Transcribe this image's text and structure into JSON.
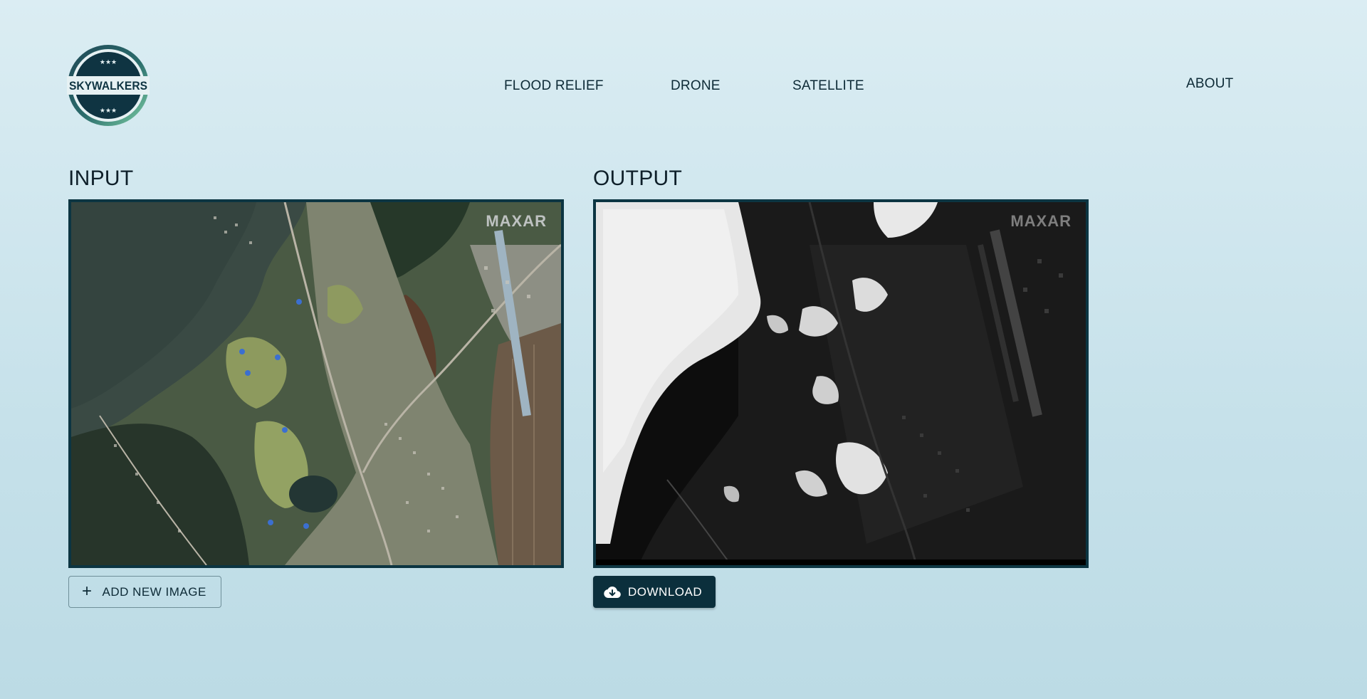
{
  "brand": {
    "name": "SKYWALKERS",
    "stars_top": "★★★",
    "stars_bottom": "★★★"
  },
  "nav": {
    "items": [
      {
        "id": "flood",
        "label": "FLOOD RELIEF"
      },
      {
        "id": "drone",
        "label": "DRONE"
      },
      {
        "id": "satellite",
        "label": "SATELLITE"
      }
    ],
    "about_label": "ABOUT"
  },
  "input_panel": {
    "title": "INPUT",
    "watermark": "MAXAR",
    "button_label": "ADD NEW IMAGE",
    "button_icon": "plus-icon"
  },
  "output_panel": {
    "title": "OUTPUT",
    "watermark": "MAXAR",
    "button_label": "DOWNLOAD",
    "button_icon": "cloud-download-icon"
  },
  "colors": {
    "accent": "#0b2f3c",
    "background": "#d3e8ef",
    "text": "#0d2a36"
  }
}
